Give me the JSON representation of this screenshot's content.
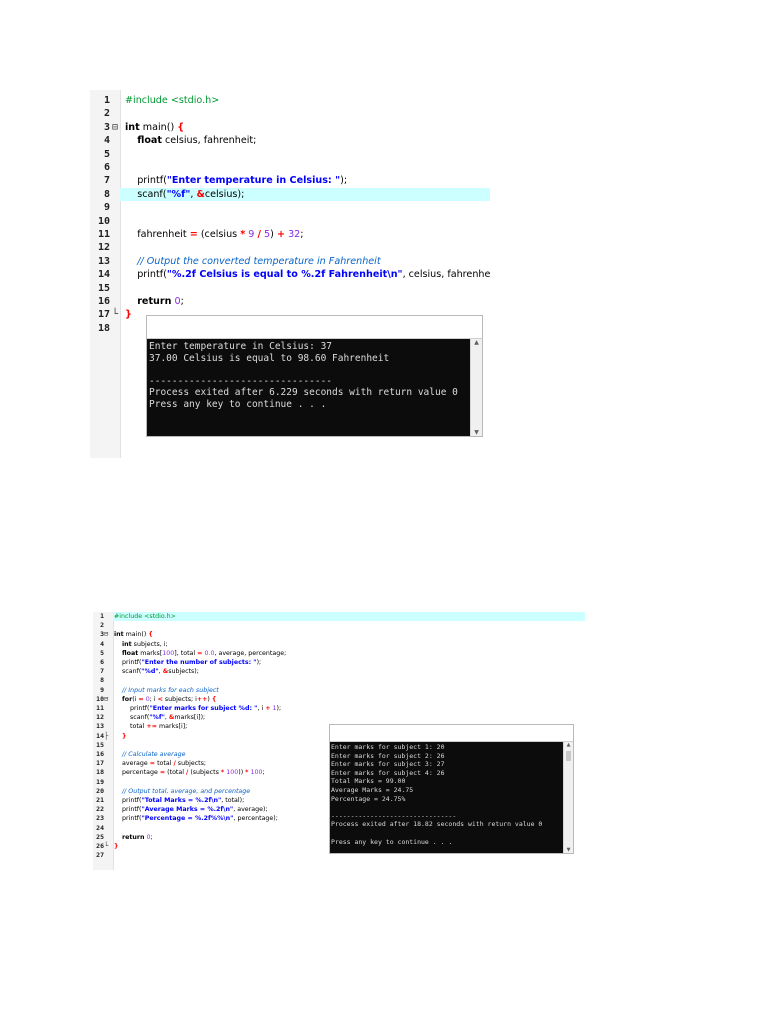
{
  "program1": {
    "lines": [
      {
        "n": "1",
        "tokens": [
          {
            "t": "#include <stdio.h>",
            "c": "pp"
          }
        ]
      },
      {
        "n": "2",
        "tokens": []
      },
      {
        "n": "3",
        "fold": "⊟",
        "tokens": [
          {
            "t": "int",
            "c": "kw"
          },
          {
            "t": " main() "
          },
          {
            "t": "{",
            "c": "brace"
          }
        ]
      },
      {
        "n": "4",
        "tokens": [
          {
            "t": "    "
          },
          {
            "t": "float",
            "c": "kw"
          },
          {
            "t": " celsius, fahrenheit;"
          }
        ]
      },
      {
        "n": "5",
        "tokens": []
      },
      {
        "n": "6",
        "tokens": []
      },
      {
        "n": "7",
        "tokens": [
          {
            "t": "    printf("
          },
          {
            "t": "\"Enter temperature in Celsius: \"",
            "c": "str"
          },
          {
            "t": ");"
          }
        ]
      },
      {
        "n": "8",
        "hl": true,
        "tokens": [
          {
            "t": "    scanf("
          },
          {
            "t": "\"%f\"",
            "c": "str"
          },
          {
            "t": ", "
          },
          {
            "t": "&",
            "c": "op"
          },
          {
            "t": "celsius);"
          }
        ]
      },
      {
        "n": "9",
        "tokens": []
      },
      {
        "n": "10",
        "tokens": []
      },
      {
        "n": "11",
        "tokens": [
          {
            "t": "    fahrenheit "
          },
          {
            "t": "=",
            "c": "op"
          },
          {
            "t": " (celsius "
          },
          {
            "t": "*",
            "c": "op"
          },
          {
            "t": " "
          },
          {
            "t": "9",
            "c": "num"
          },
          {
            "t": " "
          },
          {
            "t": "/",
            "c": "op"
          },
          {
            "t": " "
          },
          {
            "t": "5",
            "c": "num"
          },
          {
            "t": ") "
          },
          {
            "t": "+",
            "c": "op"
          },
          {
            "t": " "
          },
          {
            "t": "32",
            "c": "num"
          },
          {
            "t": ";"
          }
        ]
      },
      {
        "n": "12",
        "tokens": []
      },
      {
        "n": "13",
        "tokens": [
          {
            "t": "    "
          },
          {
            "t": "// Output the converted temperature in Fahrenheit",
            "c": "cm"
          }
        ]
      },
      {
        "n": "14",
        "tokens": [
          {
            "t": "    printf("
          },
          {
            "t": "\"%.2f Celsius is equal to %.2f Fahrenheit\\n\"",
            "c": "str"
          },
          {
            "t": ", celsius, fahrenheit);"
          }
        ]
      },
      {
        "n": "15",
        "tokens": []
      },
      {
        "n": "16",
        "tokens": [
          {
            "t": "    "
          },
          {
            "t": "return",
            "c": "kw"
          },
          {
            "t": " "
          },
          {
            "t": "0",
            "c": "num"
          },
          {
            "t": ";"
          }
        ]
      },
      {
        "n": "17",
        "fold": "└",
        "tokens": [
          {
            "t": "}",
            "c": "brace"
          }
        ]
      },
      {
        "n": "18",
        "tokens": []
      }
    ],
    "console": [
      "Enter temperature in Celsius: 37",
      "37.00 Celsius is equal to 98.60 Fahrenheit",
      "",
      "--------------------------------",
      "Process exited after 6.229 seconds with return value 0",
      "Press any key to continue . . ."
    ]
  },
  "program2": {
    "lines": [
      {
        "n": "1",
        "hl": true,
        "tokens": [
          {
            "t": "#include <stdio.h>",
            "c": "pp"
          }
        ]
      },
      {
        "n": "2",
        "tokens": []
      },
      {
        "n": "3",
        "fold": "⊟",
        "tokens": [
          {
            "t": "int",
            "c": "kw"
          },
          {
            "t": " main() "
          },
          {
            "t": "{",
            "c": "brace"
          }
        ]
      },
      {
        "n": "4",
        "tokens": [
          {
            "t": "    "
          },
          {
            "t": "int",
            "c": "kw"
          },
          {
            "t": " subjects, i;"
          }
        ]
      },
      {
        "n": "5",
        "tokens": [
          {
            "t": "    "
          },
          {
            "t": "float",
            "c": "kw"
          },
          {
            "t": " marks["
          },
          {
            "t": "100",
            "c": "num"
          },
          {
            "t": "], total "
          },
          {
            "t": "=",
            "c": "op"
          },
          {
            "t": " "
          },
          {
            "t": "0.0",
            "c": "num"
          },
          {
            "t": ", average, percentage;"
          }
        ]
      },
      {
        "n": "6",
        "tokens": [
          {
            "t": "    printf("
          },
          {
            "t": "\"Enter the number of subjects: \"",
            "c": "str"
          },
          {
            "t": ");"
          }
        ]
      },
      {
        "n": "7",
        "tokens": [
          {
            "t": "    scanf("
          },
          {
            "t": "\"%d\"",
            "c": "str"
          },
          {
            "t": ", "
          },
          {
            "t": "&",
            "c": "op"
          },
          {
            "t": "subjects);"
          }
        ]
      },
      {
        "n": "8",
        "tokens": []
      },
      {
        "n": "9",
        "tokens": [
          {
            "t": "    "
          },
          {
            "t": "// Input marks for each subject",
            "c": "cm"
          }
        ]
      },
      {
        "n": "10",
        "fold": "⊟",
        "tokens": [
          {
            "t": "    "
          },
          {
            "t": "for",
            "c": "kw"
          },
          {
            "t": "(i "
          },
          {
            "t": "=",
            "c": "op"
          },
          {
            "t": " "
          },
          {
            "t": "0",
            "c": "num"
          },
          {
            "t": "; i "
          },
          {
            "t": "<",
            "c": "op"
          },
          {
            "t": " subjects; i"
          },
          {
            "t": "++",
            "c": "op"
          },
          {
            "t": ") "
          },
          {
            "t": "{",
            "c": "brace"
          }
        ]
      },
      {
        "n": "11",
        "tokens": [
          {
            "t": "        printf("
          },
          {
            "t": "\"Enter marks for subject %d: \"",
            "c": "str"
          },
          {
            "t": ", i "
          },
          {
            "t": "+",
            "c": "op"
          },
          {
            "t": " "
          },
          {
            "t": "1",
            "c": "num"
          },
          {
            "t": ");"
          }
        ]
      },
      {
        "n": "12",
        "tokens": [
          {
            "t": "        scanf("
          },
          {
            "t": "\"%f\"",
            "c": "str"
          },
          {
            "t": ", "
          },
          {
            "t": "&",
            "c": "op"
          },
          {
            "t": "marks[i]);"
          }
        ]
      },
      {
        "n": "13",
        "tokens": [
          {
            "t": "        total "
          },
          {
            "t": "+=",
            "c": "op"
          },
          {
            "t": " marks[i];"
          }
        ]
      },
      {
        "n": "14",
        "fold": "├",
        "tokens": [
          {
            "t": "    "
          },
          {
            "t": "}",
            "c": "brace"
          }
        ]
      },
      {
        "n": "15",
        "tokens": []
      },
      {
        "n": "16",
        "tokens": [
          {
            "t": "    "
          },
          {
            "t": "// Calculate average",
            "c": "cm"
          }
        ]
      },
      {
        "n": "17",
        "tokens": [
          {
            "t": "    average "
          },
          {
            "t": "=",
            "c": "op"
          },
          {
            "t": " total "
          },
          {
            "t": "/",
            "c": "op"
          },
          {
            "t": " subjects;"
          }
        ]
      },
      {
        "n": "18",
        "tokens": [
          {
            "t": "    percentage "
          },
          {
            "t": "=",
            "c": "op"
          },
          {
            "t": " (total "
          },
          {
            "t": "/",
            "c": "op"
          },
          {
            "t": " (subjects "
          },
          {
            "t": "*",
            "c": "op"
          },
          {
            "t": " "
          },
          {
            "t": "100",
            "c": "num"
          },
          {
            "t": ")) "
          },
          {
            "t": "*",
            "c": "op"
          },
          {
            "t": " "
          },
          {
            "t": "100",
            "c": "num"
          },
          {
            "t": ";"
          }
        ]
      },
      {
        "n": "19",
        "tokens": []
      },
      {
        "n": "20",
        "tokens": [
          {
            "t": "    "
          },
          {
            "t": "// Output total, average, and percentage",
            "c": "cm"
          }
        ]
      },
      {
        "n": "21",
        "tokens": [
          {
            "t": "    printf("
          },
          {
            "t": "\"Total Marks = %.2f\\n\"",
            "c": "str"
          },
          {
            "t": ", total);"
          }
        ]
      },
      {
        "n": "22",
        "tokens": [
          {
            "t": "    printf("
          },
          {
            "t": "\"Average Marks = %.2f\\n\"",
            "c": "str"
          },
          {
            "t": ", average);"
          }
        ]
      },
      {
        "n": "23",
        "tokens": [
          {
            "t": "    printf("
          },
          {
            "t": "\"Percentage = %.2f%%\\n\"",
            "c": "str"
          },
          {
            "t": ", percentage);"
          }
        ]
      },
      {
        "n": "24",
        "tokens": []
      },
      {
        "n": "25",
        "tokens": [
          {
            "t": "    "
          },
          {
            "t": "return",
            "c": "kw"
          },
          {
            "t": " "
          },
          {
            "t": "0",
            "c": "num"
          },
          {
            "t": ";"
          }
        ]
      },
      {
        "n": "26",
        "fold": "└",
        "tokens": [
          {
            "t": "}",
            "c": "brace"
          }
        ]
      },
      {
        "n": "27",
        "tokens": []
      }
    ],
    "console": [
      "Enter marks for subject 1: 20",
      "Enter marks for subject 2: 26",
      "Enter marks for subject 3: 27",
      "Enter marks for subject 4: 26",
      "Total Marks = 99.00",
      "Average Marks = 24.75",
      "Percentage = 24.75%",
      "",
      "--------------------------------",
      "Process exited after 18.82 seconds with return value 0",
      "",
      "Press any key to continue . . ."
    ]
  },
  "scroll_arrows": {
    "up": "▲",
    "down": "▼"
  }
}
